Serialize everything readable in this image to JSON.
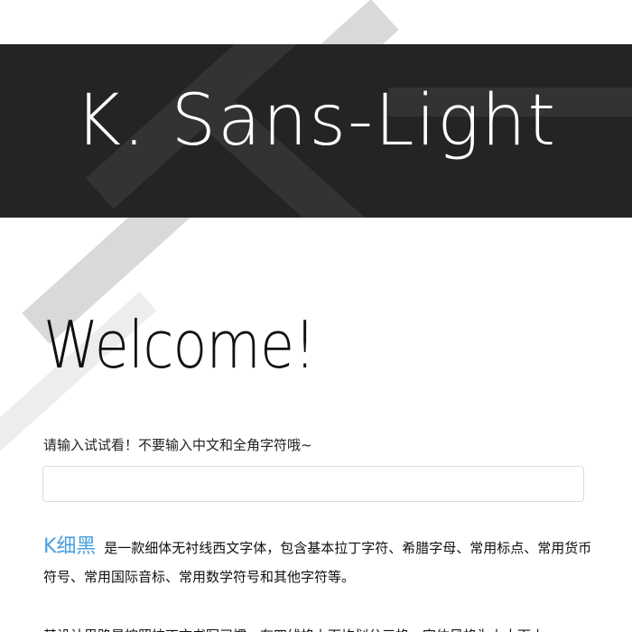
{
  "banner": {
    "title": "K. Sans-Light"
  },
  "main": {
    "welcome": "Welcome!",
    "prompt": "请输入试试看！不要输入中文和全角字符哦~",
    "input": {
      "value": "",
      "placeholder": ""
    },
    "brand_name": "K细黑",
    "description": "是一款细体无衬线西文字体，包含基本拉丁字符、希腊字母、常用标点、常用货币符号、常用国际音标、常用数学符号和其他字符等。",
    "description2": "其设计思路是按照拉丁文书写习惯，有四线格上下均划分三格，字体风格为上大下小。"
  },
  "colors": {
    "banner_bg": "#242424",
    "accent": "#4a9fe0"
  }
}
